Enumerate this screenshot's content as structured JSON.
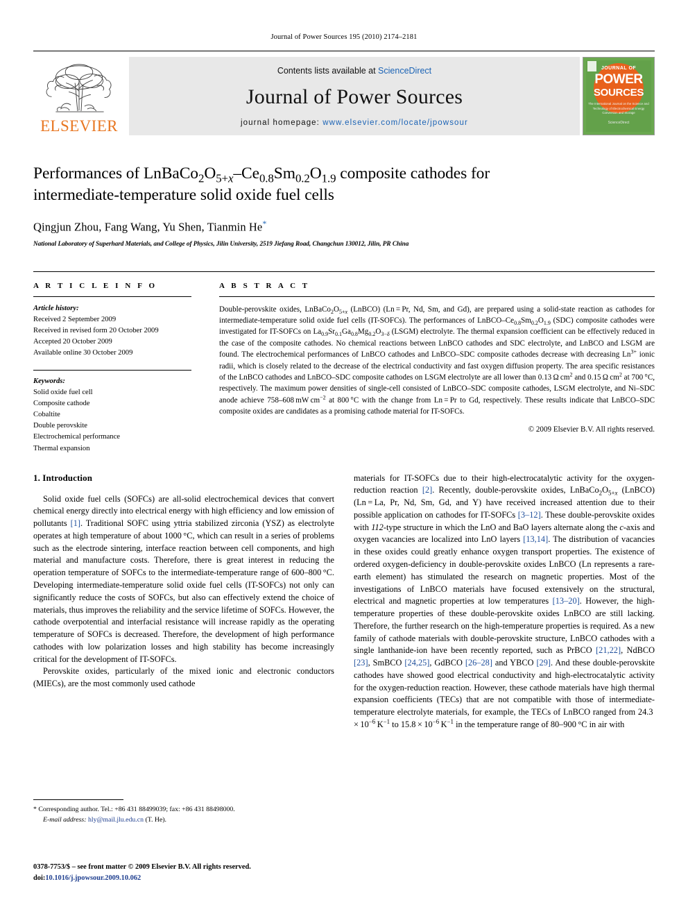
{
  "running_head": "Journal of Power Sources 195 (2010) 2174–2181",
  "masthead": {
    "contents_prefix": "Contents lists available at ",
    "sciencedirect": "ScienceDirect",
    "journal_name": "Journal of Power Sources",
    "homepage_prefix": "journal homepage: ",
    "homepage_url": "www.elsevier.com/locate/jpowsour",
    "publisher": "ELSEVIER",
    "accent_orange": "#E87722",
    "link_blue": "#1b63b5",
    "band_gray": "#e8e8e8",
    "cover": {
      "journal_of": "JOURNAL OF",
      "power": "POWER",
      "sources": "SOURCES",
      "subtitle": "The International Journal on the Science and Technology of Electro­chemical Energy Conversion and Storage",
      "badge": "ScienceDirect",
      "bg_green": "#6aa84f",
      "circle_orange": "#e8611c"
    }
  },
  "article": {
    "title_line1": "Performances of LnBaCo2O5+x–Ce0.8Sm0.2O1.9 composite cathodes for",
    "title_line2": "intermediate-temperature solid oxide fuel cells",
    "authors": "Qingjun Zhou, Fang Wang, Yu Shen, Tianmin He",
    "corresponding_marker": "*",
    "affiliation": "National Laboratory of Superhard Materials, and College of Physics, Jilin University, 2519 Jiefang Road, Changchun 130012, Jilin, PR China"
  },
  "article_info": {
    "heading": "A R T I C L E   I N F O",
    "history_label": "Article history:",
    "history": [
      "Received 2 September 2009",
      "Received in revised form 20 October 2009",
      "Accepted 20 October 2009",
      "Available online 30 October 2009"
    ],
    "keywords_label": "Keywords:",
    "keywords": [
      "Solid oxide fuel cell",
      "Composite cathode",
      "Cobaltite",
      "Double perovskite",
      "Electrochemical performance",
      "Thermal expansion"
    ]
  },
  "abstract": {
    "heading": "A B S T R A C T",
    "text": "Double-perovskite oxides, LnBaCo2O5+x (LnBCO) (Ln = Pr, Nd, Sm, and Gd), are prepared using a solid-state reaction as cathodes for intermediate-temperature solid oxide fuel cells (IT-SOFCs). The performances of LnBCO–Ce0.8Sm0.2O1.9 (SDC) composite cathodes were investigated for IT-SOFCs on La0.9Sr0.1Ga0.8Mg0.2O3−δ (LSGM) electrolyte. The thermal expansion coefficient can be effectively reduced in the case of the composite cathodes. No chemical reactions between LnBCO cathodes and SDC electrolyte, and LnBCO and LSGM are found. The electrochemical performances of LnBCO cathodes and LnBCO–SDC composite cathodes decrease with decreasing Ln3+ ionic radii, which is closely related to the decrease of the electrical conductivity and fast oxygen diffusion property. The area specific resistances of the LnBCO cathodes and LnBCO–SDC composite cathodes on LSGM electrolyte are all lower than 0.13 Ω cm2 and 0.15 Ω cm2 at 700 °C, respectively. The maximum power densities of single-cell consisted of LnBCO–SDC composite cathodes, LSGM electrolyte, and Ni–SDC anode achieve 758–608 mW cm−2 at 800 °C with the change from Ln = Pr to Gd, respectively. These results indicate that LnBCO–SDC composite oxides are candidates as a promising cathode material for IT-SOFCs.",
    "copyright": "© 2009 Elsevier B.V. All rights reserved."
  },
  "introduction": {
    "heading": "1. Introduction",
    "left_para1": "Solid oxide fuel cells (SOFCs) are all-solid electrochemical devices that convert chemical energy directly into electrical energy with high efficiency and low emission of pollutants [1]. Traditional SOFC using yttria stabilized zirconia (YSZ) as electrolyte operates at high temperature of about 1000 °C, which can result in a series of problems such as the electrode sintering, interface reaction between cell components, and high material and manufacture costs. Therefore, there is great interest in reducing the operation temperature of SOFCs to the intermediate-temperature range of 600–800 °C. Developing intermediate-temperature solid oxide fuel cells (IT-SOFCs) not only can significantly reduce the costs of SOFCs, but also can effectively extend the choice of materials, thus improves the reliability and the service lifetime of SOFCs. However, the cathode overpotential and interfacial resistance will increase rapidly as the operating temperature of SOFCs is decreased. Therefore, the development of high performance cathodes with low polarization losses and high stability has become increasingly critical for the development of IT-SOFCs.",
    "left_para2": "Perovskite oxides, particularly of the mixed ionic and electronic conductors (MIECs), are the most commonly used cathode",
    "right_para": "materials for IT-SOFCs due to their high-electrocatalytic activity for the oxygen-reduction reaction [2]. Recently, double-perovskite oxides, LnBaCo2O5+x (LnBCO) (Ln = La, Pr, Nd, Sm, Gd, and Y) have received increased attention due to their possible application on cathodes for IT-SOFCs [3–12]. These double-perovskite oxides with 112-type structure in which the LnO and BaO layers alternate along the c-axis and oxygen vacancies are localized into LnO layers [13,14]. The distribution of vacancies in these oxides could greatly enhance oxygen transport properties. The existence of ordered oxygen-deficiency in double-perovskite oxides LnBCO (Ln represents a rare-earth element) has stimulated the research on magnetic properties. Most of the investigations of LnBCO materials have focused extensively on the structural, electrical and magnetic properties at low temperatures [13–20]. However, the high-temperature properties of these double-perovskite oxides LnBCO are still lacking. Therefore, the further research on the high-temperature properties is required. As a new family of cathode materials with double-perovskite structure, LnBCO cathodes with a single lanthanide-ion have been recently reported, such as PrBCO [21,22], NdBCO [23], SmBCO [24,25], GdBCO [26–28] and YBCO [29]. And these double-perovskite cathodes have showed good electrical conductivity and high-electrocatalytic activity for the oxygen-reduction reaction. However, these cathode materials have high thermal expansion coefficients (TECs) that are not compatible with those of intermediate-temperature electrolyte materials, for example, the TECs of LnBCO ranged from 24.3 × 10−6 K−1 to 15.8 × 10−6 K−1 in the temperature range of 80–900 °C in air with"
  },
  "footnotes": {
    "corresponding": "* Corresponding author. Tel.: +86 431 88499039; fax: +86 431 88498000.",
    "email_label": "E-mail address:",
    "email": "hly@mail.jlu.edu.cn",
    "email_suffix": "(T. He)."
  },
  "imprint": {
    "issn_line": "0378-7753/$ – see front matter © 2009 Elsevier B.V. All rights reserved.",
    "doi_label": "doi:",
    "doi": "10.1016/j.jpowsour.2009.10.062"
  }
}
